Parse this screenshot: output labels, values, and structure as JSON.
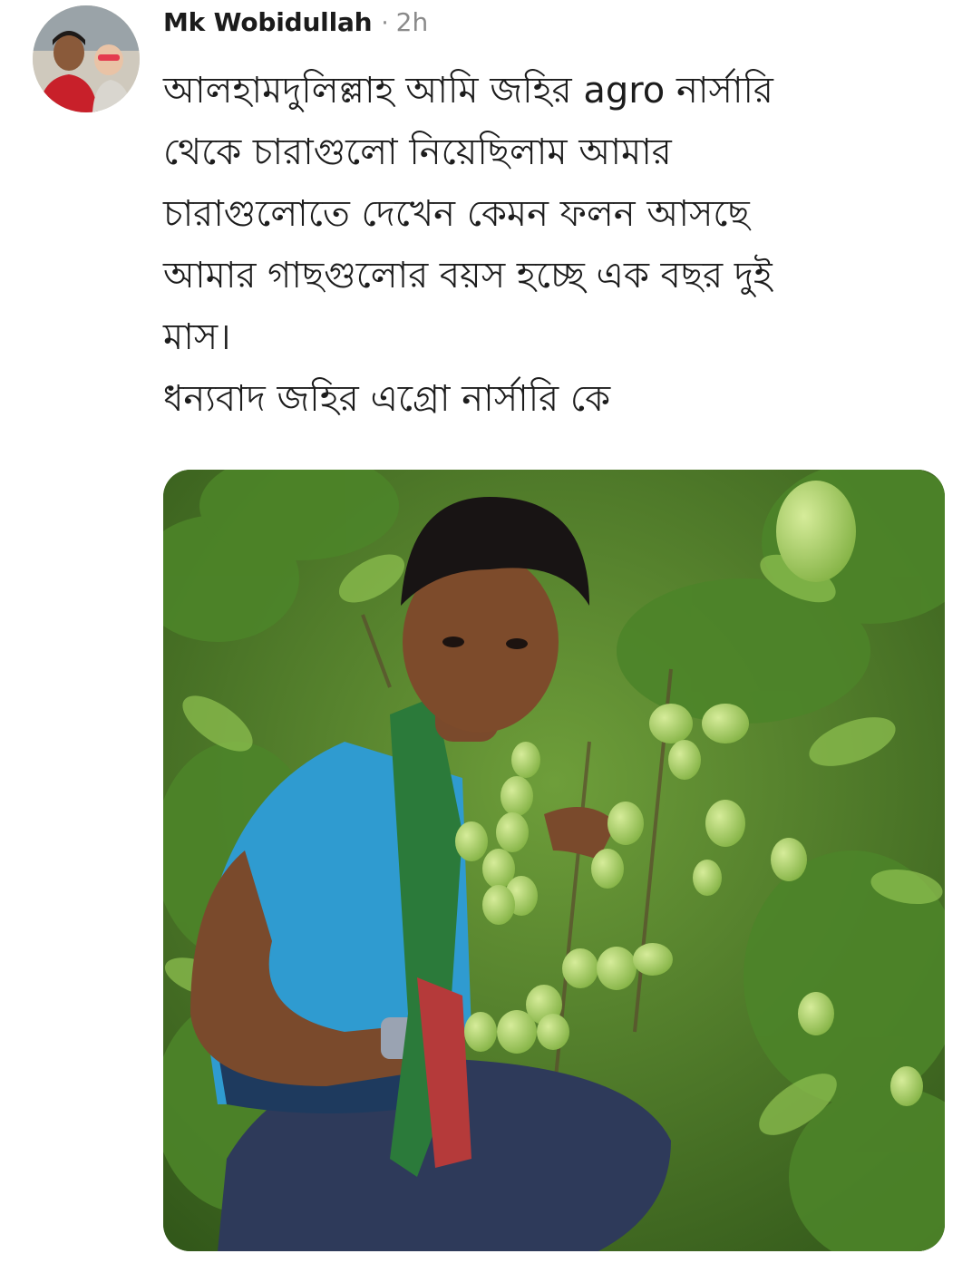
{
  "post": {
    "author": "Mk Wobidullah",
    "separator": "·",
    "timestamp": "2h",
    "text_lines": [
      "আলহামদুলিল্লাহ আমি জহির agro নার্সারি",
      "থেকে চারাগুলো নিয়েছিলাম আমার",
      "চারাগুলোতে দেখেন কেমন ফলন আসছে",
      "আমার গাছগুলোর বয়স হচ্ছে এক বছর দুই",
      "মাস।",
      "ধন্যবাদ জহির এগ্রো নার্সারি কে"
    ],
    "avatar_icon": "profile-photo",
    "photo_icon": "post-photo"
  },
  "colors": {
    "text": "#1c1c1c",
    "meta": "#8a8a8a",
    "leaf_dark": "#3f6b22",
    "leaf_light": "#7fb24a",
    "fruit": "#a9d16a",
    "shirt": "#2f9bd0"
  }
}
